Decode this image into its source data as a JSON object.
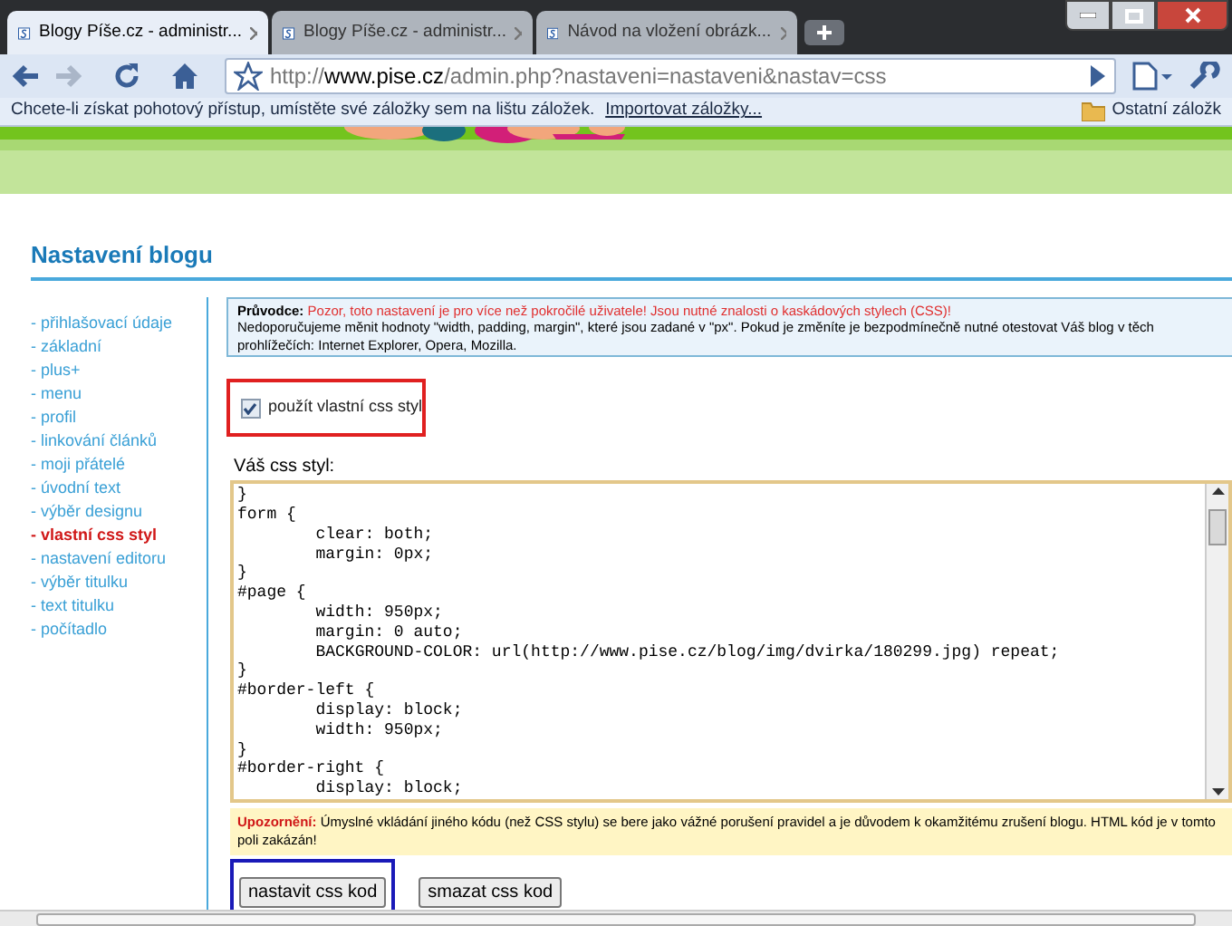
{
  "browser": {
    "tabs": [
      {
        "title": "Blogy Píše.cz - administr...",
        "selected": true
      },
      {
        "title": "Blogy Píše.cz - administr...",
        "selected": false
      },
      {
        "title": "Návod na vložení obrázk...",
        "selected": false
      }
    ],
    "address": {
      "scheme": "http://",
      "host": "www.pise.cz",
      "path": "/admin.php?nastaveni=nastaveni&nastav=css"
    },
    "bookmarks_bar": {
      "message": "Chcete-li získat pohotový přístup, umístěte své záložky sem na lištu záložek.",
      "import_link": "Importovat záložky...",
      "other": "Ostatní záložk"
    }
  },
  "page": {
    "heading": "Nastavení blogu",
    "sidebar": [
      {
        "label": "- přihlašovací údaje",
        "selected": false
      },
      {
        "label": "- základní",
        "selected": false
      },
      {
        "label": "- plus+",
        "selected": false
      },
      {
        "label": "- menu",
        "selected": false
      },
      {
        "label": "- profil",
        "selected": false
      },
      {
        "label": "- linkování článků",
        "selected": false
      },
      {
        "label": "- moji přátelé",
        "selected": false
      },
      {
        "label": "- úvodní text",
        "selected": false
      },
      {
        "label": "- výběr designu",
        "selected": false
      },
      {
        "label": "- vlastní css styl",
        "selected": true
      },
      {
        "label": "- nastavení editoru",
        "selected": false
      },
      {
        "label": "- výběr titulku",
        "selected": false
      },
      {
        "label": "- text titulku",
        "selected": false
      },
      {
        "label": "- počítadlo",
        "selected": false
      }
    ],
    "guide": {
      "text": "**Průvodce:** Pozor, toto nastavení je pro více než pokročilé uživatele! Jsou nutné znalosti o kaskádových stylech (CSS)!",
      "detail": "Nedoporučujeme měnit hodnoty \"width, padding, margin\", které jsou zadané v \"px\". Pokud je změníte je bezpodmínečně nutné otestovat Váš blog v těch prohlížečích: Internet Explorer, Opera, Mozilla."
    },
    "checkbox": {
      "label": "použít vlastní css styl",
      "checked": true,
      "highlighted": true
    },
    "css_label": "Váš css styl:",
    "css_lines": [
      "}",
      "form {",
      "\tclear: both;",
      "\tmargin: 0px;",
      "}",
      "#page {",
      "\twidth: 950px;",
      "\tmargin: 0 auto;",
      "\tBACKGROUND-COLOR: url(http://www.pise.cz/blog/img/dvirka/180299.jpg) repeat;",
      "}",
      "#border-left {",
      "\tdisplay: block;",
      "\twidth: 950px;",
      "}",
      "#border-right {",
      "\tdisplay: block;"
    ],
    "warning": {
      "label": "Upozornění:",
      "text": "Úmyslné vkládání jiného kódu (než CSS stylu) se bere jako vážné porušení pravidel a je důvodem k okamžitému zrušení blogu. HTML kód je v tomto poli zakázán!"
    },
    "buttons": [
      {
        "label": "nastavit css kod",
        "highlighted": true
      },
      {
        "label": "smazat css kod",
        "highlighted": false
      }
    ]
  }
}
